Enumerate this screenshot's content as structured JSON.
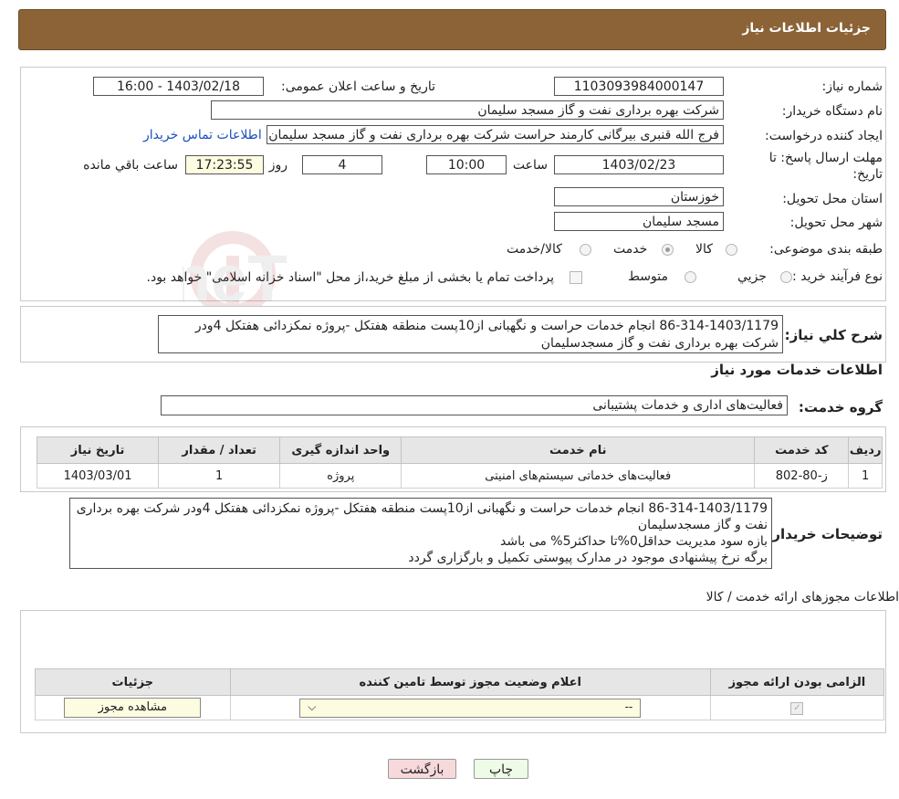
{
  "header": {
    "title": "جزئیات اطلاعات نیاز"
  },
  "form": {
    "need_number_label": "شماره نیاز:",
    "need_number": "1103093984000147",
    "announce_label": "تاریخ و ساعت اعلان عمومی:",
    "announce_value": "1403/02/18 - 16:00",
    "buyer_org_label": "نام دستگاه خریدار:",
    "buyer_org": "شرکت بهره برداری نفت و گاز مسجد سلیمان",
    "creator_label": "ایجاد کننده درخواست:",
    "creator": "فرج الله قنبری بیرگانی کارمند حراست شرکت بهره برداری نفت و گاز مسجد سلیمان",
    "contact_link": "اطلاعات تماس خریدار",
    "deadline_label_1": "مهلت ارسال پاسخ: تا",
    "deadline_label_2": "تاریخ:",
    "deadline_date": "1403/02/23",
    "time_label": "ساعت",
    "deadline_time": "10:00",
    "days_value": "4",
    "days_label": "روز و",
    "remaining_time": "17:23:55",
    "remaining_label": "ساعت باقي مانده",
    "province_label": "استان محل تحویل:",
    "province": "خوزستان",
    "city_label": "شهر محل تحویل:",
    "city": "مسجد سلیمان",
    "category_label": "طبقه بندی موضوعی:",
    "category_options": [
      "کالا",
      "خدمت",
      "کالا/خدمت"
    ],
    "purchase_type_label": "نوع فرآیند خرید :",
    "purchase_options": [
      "جزیي",
      "متوسط"
    ],
    "purchase_note": "پرداخت تمام یا بخشی از مبلغ خرید،از محل \"اسناد خزانه اسلامی\" خواهد بود."
  },
  "summary": {
    "label": "شرح کلي نياز:",
    "text": "86-314-1403/1179 انجام خدمات حراست و نگهبانی از10پست منطقه هفتکل -پروژه نمکزدائی هفتکل 4ودر شرکت بهره برداری نفت و گاز مسجدسلیمان"
  },
  "services": {
    "section_title": "اطلاعات خدمات مورد نیاز",
    "group_label": "گروه خدمت:",
    "group_value": "فعالیت‌های اداری و خدمات پشتیبانی",
    "columns": [
      "ردیف",
      "کد خدمت",
      "نام خدمت",
      "واحد اندازه گیری",
      "تعداد / مقدار",
      "تاریخ نیاز"
    ],
    "rows": [
      [
        "1",
        "ز-80-802",
        "فعالیت‌های خدماتی سیستم‌های امنیتی",
        "پروژه",
        "1",
        "1403/03/01"
      ]
    ]
  },
  "buyer_notes": {
    "label": "توضیحات خریدار:",
    "line1": "86-314-1403/1179 انجام خدمات حراست و نگهبانی از10پست منطقه هفتکل -پروژه نمکزدائی هفتکل 4ودر شرکت بهره برداری نفت و گاز مسجدسلیمان",
    "line2": "بازه سود مدیریت حداقل0%تا حداکثر5% می باشد",
    "line3": "برگه نرخ پیشنهادی موجود در مدارک پیوستی تکمیل و بارگزاری گردد"
  },
  "permits": {
    "section_title": "اطلاعات مجوزهای ارائه خدمت / کالا",
    "columns": [
      "الزامی بودن ارائه مجوز",
      "اعلام وضعیت مجوز توسط تامین کننده",
      "جزئیات"
    ],
    "select_value": "--",
    "view_button": "مشاهده مجوز"
  },
  "actions": {
    "print": "چاپ",
    "back": "بازگشت"
  },
  "watermark": {
    "text": "AriaTender.neT"
  },
  "colors": {
    "header_bg": "#8b6337",
    "link": "#1a4fbf",
    "back_btn": "#f7d9dc",
    "print_btn": "#eefbe6"
  }
}
